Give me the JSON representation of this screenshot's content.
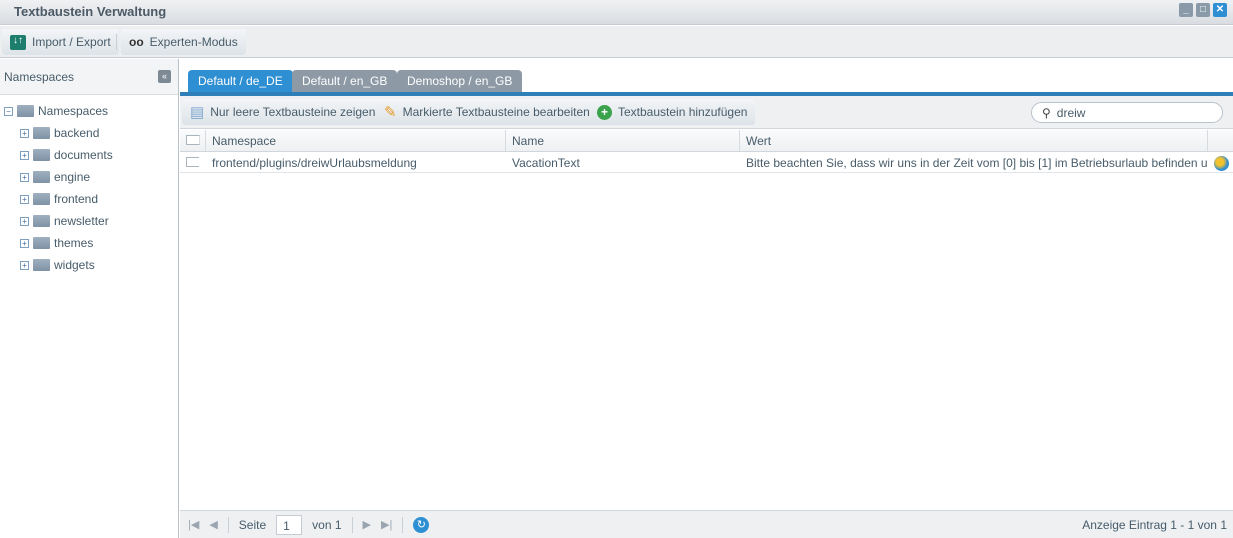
{
  "window": {
    "title": "Textbaustein Verwaltung"
  },
  "toolbar": {
    "import_export": "Import / Export",
    "expert_mode": "Experten-Modus"
  },
  "sidebar": {
    "title": "Namespaces",
    "root": "Namespaces",
    "items": [
      {
        "label": "backend"
      },
      {
        "label": "documents"
      },
      {
        "label": "engine"
      },
      {
        "label": "frontend"
      },
      {
        "label": "newsletter"
      },
      {
        "label": "themes"
      },
      {
        "label": "widgets"
      }
    ]
  },
  "tabs": [
    {
      "label": "Default / de_DE",
      "active": true
    },
    {
      "label": "Default / en_GB"
    },
    {
      "label": "Demoshop / en_GB"
    }
  ],
  "grid_toolbar": {
    "empty_only": "Nur leere Textbausteine zeigen",
    "edit_marked": "Markierte Textbausteine bearbeiten",
    "add": "Textbaustein hinzufügen",
    "search_value": "dreiw"
  },
  "grid": {
    "columns": [
      "Namespace",
      "Name",
      "Wert"
    ],
    "rows": [
      {
        "namespace": "frontend/plugins/dreiwUrlaubsmeldung",
        "name": "VacationText",
        "value": "Bitte beachten Sie, dass wir uns in der Zeit vom [0] bis [1] im Betriebsurlaub befinden und in ..."
      }
    ]
  },
  "pager": {
    "page_label": "Seite",
    "page": "1",
    "of": "von 1",
    "summary": "Anzeige Eintrag 1 - 1 von 1"
  },
  "colors": {
    "accent": "#2f8fd3"
  }
}
